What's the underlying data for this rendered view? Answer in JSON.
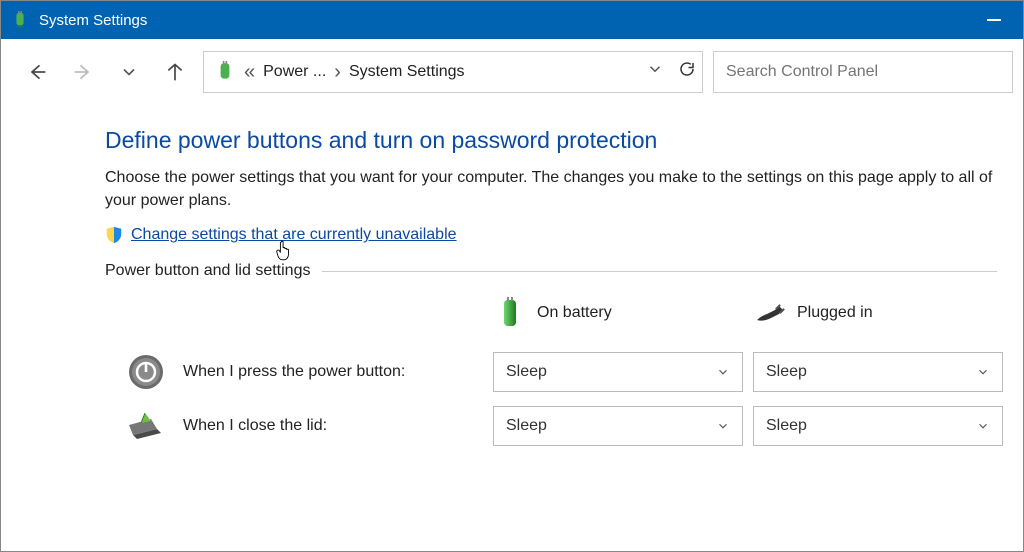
{
  "titlebar": {
    "title": "System Settings"
  },
  "address": {
    "crumb1": "Power ...",
    "crumb2": "System Settings"
  },
  "search": {
    "placeholder": "Search Control Panel"
  },
  "main": {
    "heading": "Define power buttons and turn on password protection",
    "description": "Choose the power settings that you want for your computer. The changes you make to the settings on this page apply to all of your power plans.",
    "change_link": "Change settings that are currently unavailable",
    "section_title": "Power button and lid settings",
    "col_battery": "On battery",
    "col_plugged": "Plugged in",
    "rows": {
      "power_button": {
        "label": "When I press the power button:",
        "battery_value": "Sleep",
        "plugged_value": "Sleep"
      },
      "close_lid": {
        "label": "When I close the lid:",
        "battery_value": "Sleep",
        "plugged_value": "Sleep"
      }
    }
  }
}
